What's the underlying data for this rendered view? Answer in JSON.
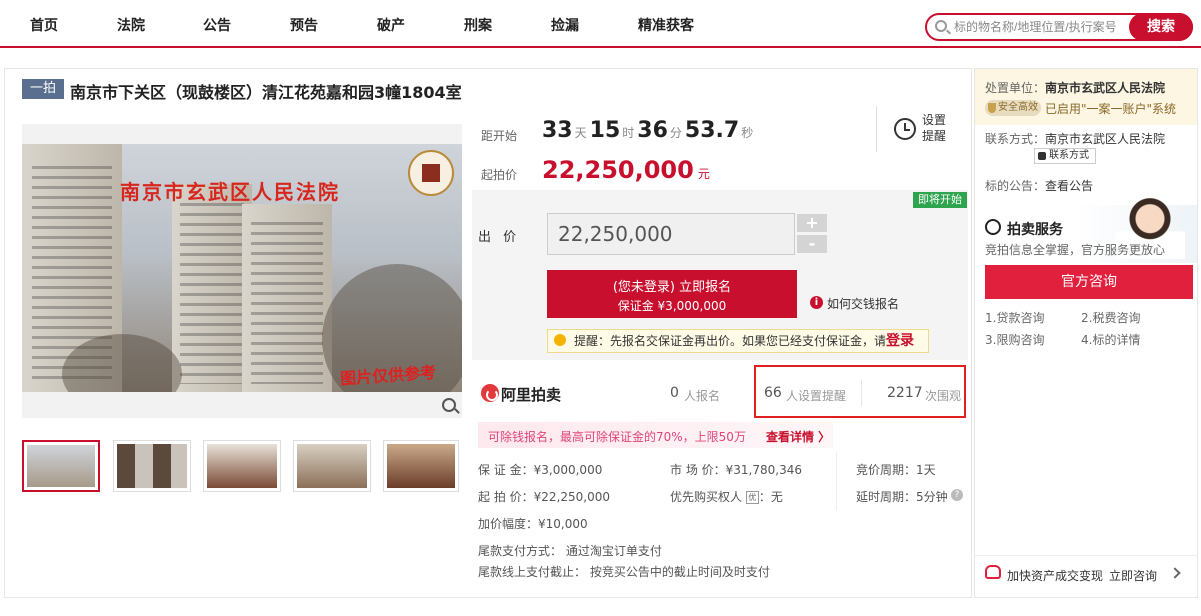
{
  "nav": {
    "items": [
      "首页",
      "法院",
      "公告",
      "预告",
      "破产",
      "刑案",
      "捡漏",
      "精准获客"
    ],
    "search_placeholder": "标的物名称/地理位置/执行案号",
    "search_button": "搜索"
  },
  "item": {
    "tag": "一拍",
    "title": "南京市下关区（现鼓楼区）清江花苑嘉和园3幢1804室",
    "photo_court": "南京市玄武区人民法院",
    "photo_caption": "图片仅供参考"
  },
  "countdown": {
    "label": "距开始",
    "days": "33",
    "days_unit": "天",
    "hours": "15",
    "hours_unit": "时",
    "minutes": "36",
    "minutes_unit": "分",
    "seconds": "53.7",
    "seconds_unit": "秒",
    "reminder": "设置提醒"
  },
  "price": {
    "label": "起拍价",
    "value": "22,250,000",
    "unit": "元"
  },
  "bid": {
    "badge": "即将开始",
    "label": "出 价",
    "value": "22,250,000",
    "plus": "+",
    "minus": "-",
    "signup_line1": "(您未登录) 立即报名",
    "signup_line2": "保证金 ¥3,000,000",
    "howto": "如何交钱报名",
    "tip_text": "提醒：先报名交保证金再出价。如果您已经支付保证金，请",
    "tip_login": "登录"
  },
  "stats": {
    "brand": "阿里拍卖",
    "signups_n": "0",
    "signups_l": "人报名",
    "reminders_n": "66",
    "reminders_l": "人设置提醒",
    "views_n": "2217",
    "views_l": "次围观"
  },
  "promo": {
    "text": "可除钱报名，最高可除保证金的70%，上限50万",
    "more": "查看详情 〉"
  },
  "info": {
    "deposit": "保 证 金：¥3,000,000",
    "market": "市 场 价：¥31,780,346",
    "cycle": "竞价周期：1天",
    "start": "起 拍 价：¥22,250,000",
    "priority_label": "优先购买权人",
    "priority_icon": "优",
    "priority_value": "：无",
    "delay": "延时周期：5分钟",
    "increment": "加价幅度：¥10,000",
    "pay_method": "尾款支付方式： 通过淘宝订单支付",
    "pay_deadline": "尾款线上支付截止： 按竞买公告中的截止时间及时支付"
  },
  "side": {
    "org_label": "处置单位：",
    "org": "南京市玄武区人民法院",
    "safe_badge": "安全高效",
    "system": "已启用\"一案一账户\"系统",
    "contact_label": "联系方式：",
    "contact_org": "南京市玄武区人民法院",
    "contact_btn": "联系方式",
    "notice_label": "标的公告：",
    "notice_link": "查看公告",
    "service_title": "拍卖服务",
    "service_sub": "竞拍信息全掌握，官方服务更放心",
    "consult_btn": "官方咨询",
    "questions": [
      "1.贷款咨询",
      "2.税费咨询",
      "3.限购咨询",
      "4.标的详情"
    ],
    "bottom_text": "加快资产成交变现",
    "bottom_link": "立即咨询"
  },
  "colors": {
    "accent": "#c8102e",
    "highlight": "#e0201e",
    "link": "#2a6bd8"
  }
}
